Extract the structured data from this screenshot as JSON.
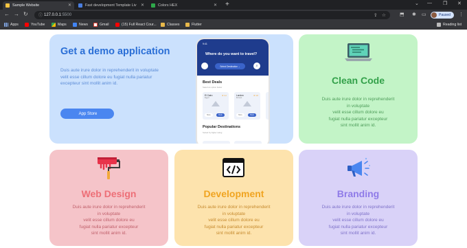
{
  "browser": {
    "tabs": [
      {
        "title": "Sample Website",
        "active": true,
        "favicon_color": "#f9c542"
      },
      {
        "title": "Fast development Template Liv",
        "active": false,
        "favicon_color": "#4a7ee0"
      },
      {
        "title": "Colors HEX",
        "active": false,
        "favicon_color": "#2ea84a"
      }
    ],
    "new_tab_icon": "plus-icon",
    "url_host": "127.0.0.1",
    "url_port": ":5500",
    "profile_label": "Paused",
    "bookmarks": [
      {
        "label": "Apps",
        "icon": "apps-grid-icon"
      },
      {
        "label": "YouTube",
        "icon": "youtube-icon"
      },
      {
        "label": "Maps",
        "icon": "maps-icon"
      },
      {
        "label": "News",
        "icon": "news-icon"
      },
      {
        "label": "Gmail",
        "icon": "gmail-icon"
      },
      {
        "label": "(15) Full React Cour...",
        "icon": "youtube-icon"
      },
      {
        "label": "Classes",
        "icon": "folder-icon"
      },
      {
        "label": "Flutter",
        "icon": "folder-icon"
      }
    ],
    "reading_list_label": "Reading list"
  },
  "demo_card": {
    "title": "Get a demo application",
    "body": "Duis aute irure dolor in reprehenderit in voluptate velit esse cillum dolore eu fugiat nulla pariatur excepteur sint mollit anim id.",
    "button_label": "App Store",
    "phone": {
      "time": "9:41",
      "question": "Where do you want to travel?",
      "select_label": "Select Destination",
      "deals_title": "Best Deals",
      "deals_sub": "Select an option below",
      "deals": [
        {
          "city": "El Cairo",
          "country": "Egypt",
          "stars": "★ 4.2",
          "btn1": "More",
          "btn2": "Book"
        },
        {
          "city": "London",
          "country": "Europe",
          "stars": "★ 4.8",
          "btn1": "More",
          "btn2": "Book"
        }
      ],
      "popular_title": "Popular Destinations",
      "popular_sub": "Sorted by higher rating"
    }
  },
  "clean_card": {
    "title": "Clean Code",
    "body_lines": [
      "Duis aute irure dolor in reprehenderit",
      "in voluptate",
      "velit esse cillum dolore eu",
      "fugiat nulla pariatur excepteur",
      "sint mollit anim id."
    ]
  },
  "web_card": {
    "title": "Web Design",
    "body_lines": [
      "Duis aute irure dolor in reprehenderit",
      "in voluptate",
      "velit esse cillum dolore eu",
      "fugiat nulla pariatur excepteur",
      "sint mollit anim id."
    ]
  },
  "dev_card": {
    "title": "Development",
    "body_lines": [
      "Duis aute irure dolor in reprehenderit",
      "in voluptate",
      "velit esse cillum dolore eu",
      "fugiat nulla pariatur excepteur",
      "sint mollit anim id."
    ]
  },
  "brand_card": {
    "title": "Branding",
    "body_lines": [
      "Duis aute irure dolor in reprehenderit",
      "in voluptate",
      "velit esse cillum dolore eu",
      "fugiat nulla pariatur excepteur",
      "sint mollit anim id."
    ]
  }
}
